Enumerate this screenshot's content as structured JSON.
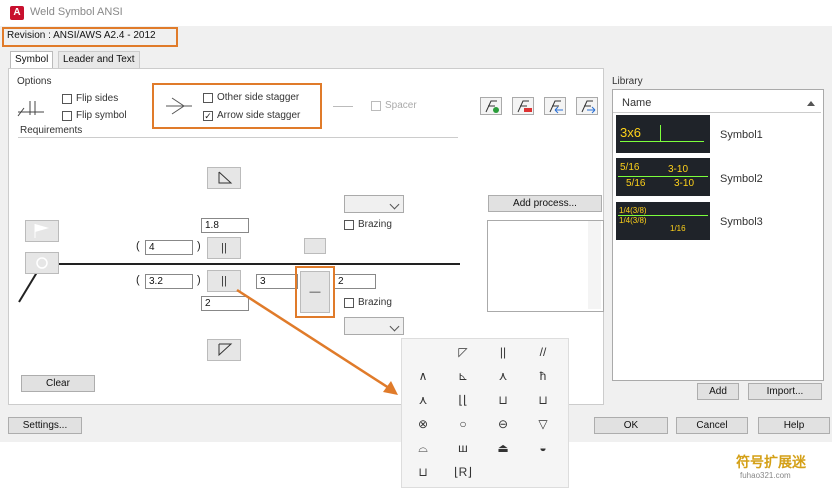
{
  "window": {
    "title": "Weld Symbol ANSI",
    "app_icon": "A"
  },
  "revision": "Revision : ANSI/AWS A2.4 - 2012",
  "tabs": [
    {
      "label": "Symbol"
    },
    {
      "label": "Leader and Text"
    }
  ],
  "options": {
    "heading": "Options",
    "flip_sides": "Flip sides",
    "flip_symbol": "Flip symbol",
    "other_side_stagger": "Other side stagger",
    "arrow_side_stagger": "Arrow side stagger",
    "spacer": "Spacer"
  },
  "requirements": {
    "heading": "Requirements"
  },
  "fields": {
    "top_size": "1.8",
    "top_length": "4",
    "bottom_size": "3.2",
    "bottom_pitch": "3",
    "bottom_extra": "2",
    "bottom_below": "2",
    "paren_open": "(",
    "paren_close": ")"
  },
  "brazing_top": "Brazing",
  "brazing_bottom": "Brazing",
  "buttons": {
    "add_process": "Add process...",
    "clear": "Clear",
    "settings": "Settings...",
    "ok": "OK",
    "cancel": "Cancel",
    "help": "Help",
    "add": "Add",
    "import": "Import..."
  },
  "library": {
    "heading": "Library",
    "column": "Name",
    "items": [
      {
        "name": "Symbol1",
        "preview": "3x6"
      },
      {
        "name": "Symbol2",
        "preview_a": "5/16",
        "preview_b": "3-10",
        "preview_c": "5/16",
        "preview_d": "3-10"
      },
      {
        "name": "Symbol3",
        "preview_a": "1/4(3/8)",
        "preview_b": "1/4(3/8)",
        "preview_c": "1/16"
      }
    ]
  },
  "popup_symbols": [
    "",
    "◸",
    "||",
    "//",
    "∧",
    "⊾",
    "⋏",
    "ħ",
    "⋏",
    "⌊⌊",
    "⊔",
    "⊔",
    "⊗",
    "○",
    "⊖",
    "▽",
    "⌓",
    "ш",
    "⏏",
    "◒",
    "⊔",
    "⌊R⌋",
    "",
    ""
  ],
  "colors": {
    "accent_orange": "#e07b2a",
    "lib_bg": "#1f2329",
    "lib_green": "#7cff3c",
    "lib_yellow": "#ffd21a"
  },
  "watermark": {
    "main": "符号扩展迷",
    "sub": "fuhao321.com"
  }
}
